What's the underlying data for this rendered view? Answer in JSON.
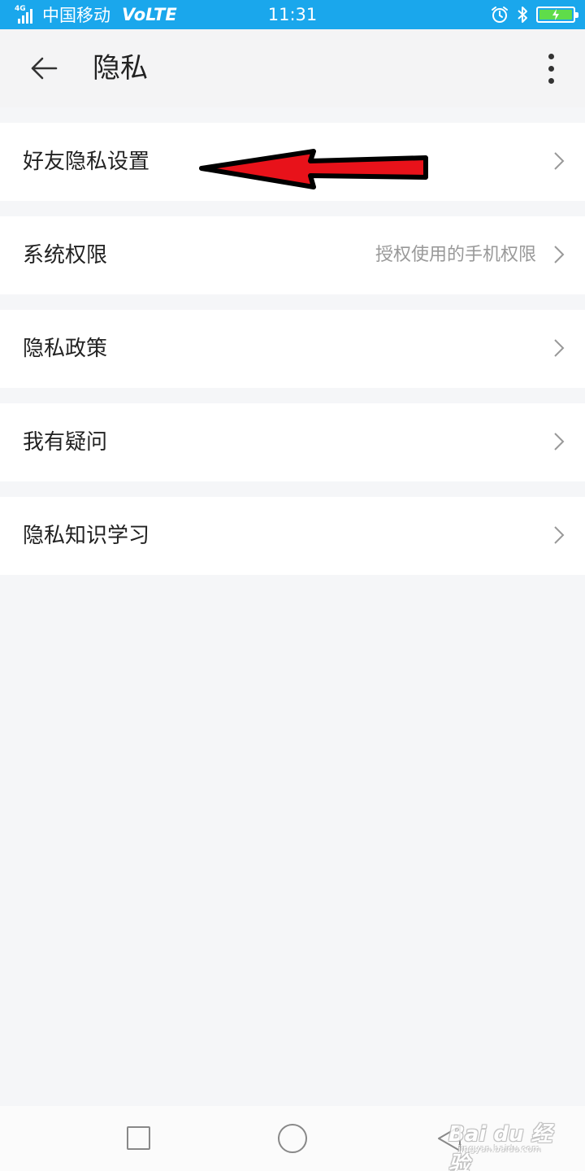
{
  "status_bar": {
    "network_type": "4G",
    "carrier": "中国移动",
    "volte": "VoLTE",
    "time": "11:31",
    "battery_color": "#5fdc4a"
  },
  "header": {
    "title": "隐私",
    "back_icon": "arrow-left-icon",
    "more_icon": "more-vertical-icon"
  },
  "menu": [
    {
      "label": "好友隐私设置",
      "value": ""
    },
    {
      "label": "系统权限",
      "value": "授权使用的手机权限"
    },
    {
      "label": "隐私政策",
      "value": ""
    },
    {
      "label": "我有疑问",
      "value": ""
    },
    {
      "label": "隐私知识学习",
      "value": ""
    }
  ],
  "annotation": {
    "arrow_color": "#e8121a",
    "points_to": "好友隐私设置"
  },
  "watermark": {
    "brand": "Bai du 经验",
    "url": "jingyan.baidu.com"
  },
  "theme": {
    "status_bar_bg": "#1aa7ec",
    "page_bg": "#f5f6f8"
  }
}
